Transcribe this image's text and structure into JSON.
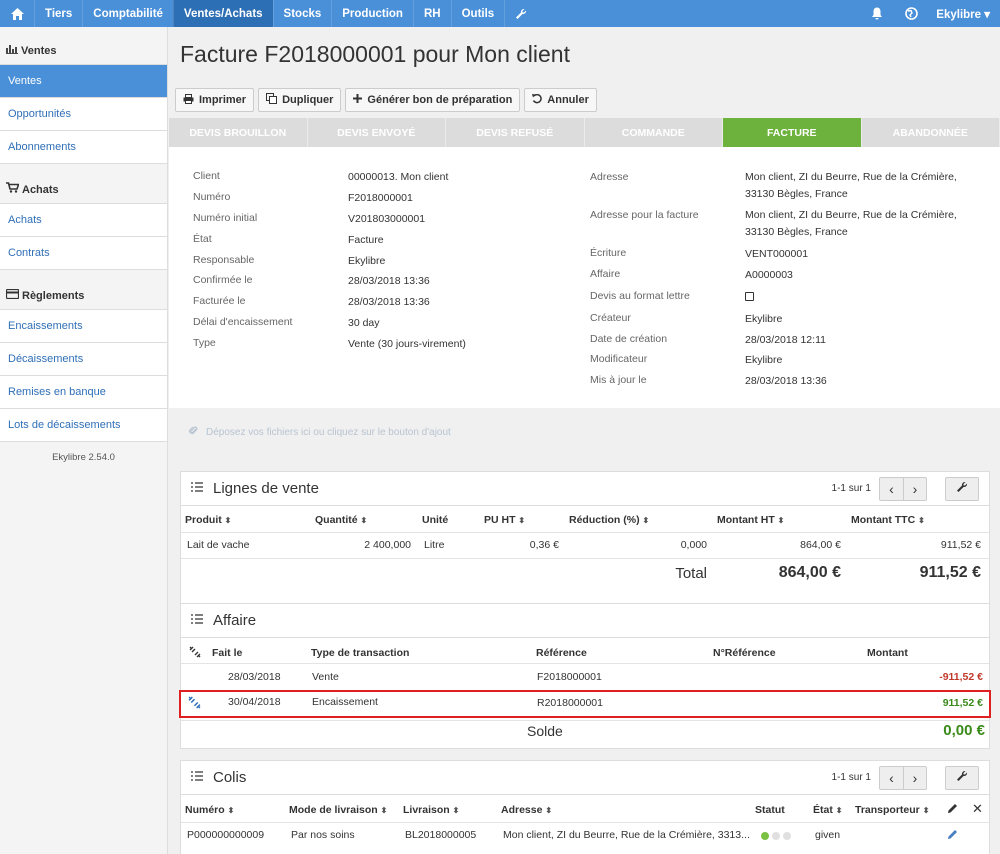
{
  "nav": {
    "menu": [
      "Tiers",
      "Comptabilité",
      "Ventes/Achats",
      "Stocks",
      "Production",
      "RH",
      "Outils"
    ],
    "user": "Ekylibre"
  },
  "sidebar": {
    "sections": [
      {
        "title": "Ventes",
        "items": [
          "Ventes",
          "Opportunités",
          "Abonnements"
        ]
      },
      {
        "title": "Achats",
        "items": [
          "Achats",
          "Contrats"
        ]
      },
      {
        "title": "Règlements",
        "items": [
          "Encaissements",
          "Décaissements",
          "Remises en banque",
          "Lots de décaissements"
        ]
      }
    ],
    "version": "Ekylibre 2.54.0"
  },
  "page": {
    "title": "Facture F2018000001 pour Mon client",
    "actions": [
      "Imprimer",
      "Dupliquer",
      "Générer bon de préparation",
      "Annuler"
    ],
    "steps": [
      "DEVIS BROUILLON",
      "DEVIS ENVOYÉ",
      "DEVIS REFUSÉ",
      "COMMANDE",
      "FACTURE",
      "ABANDONNÉE"
    ],
    "dropzone": "Déposez vos fichiers ici ou cliquez sur le bouton d'ajout"
  },
  "info_left": [
    {
      "label": "Client",
      "value": "00000013. Mon client",
      "link": true
    },
    {
      "label": "Numéro",
      "value": "F2018000001"
    },
    {
      "label": "Numéro initial",
      "value": "V201803000001"
    },
    {
      "label": "État",
      "value": "Facture"
    },
    {
      "label": "Responsable",
      "value": "Ekylibre"
    },
    {
      "label": "Confirmée le",
      "value": "28/03/2018 13:36"
    },
    {
      "label": "Facturée le",
      "value": "28/03/2018 13:36"
    },
    {
      "label": "Délai d'encaissement",
      "value": "30 day"
    },
    {
      "label": "Type",
      "value": "Vente (30 jours-virement)"
    }
  ],
  "info_right": {
    "adresse_label": "Adresse",
    "adresse_1": "Mon client, ZI du Beurre, Rue de la Crémière,",
    "adresse_2": "33130 Bègles, France",
    "adresse_fact_label": "Adresse pour la facture",
    "adresse_fact_1": "Mon client, ZI du Beurre, Rue de la Crémière,",
    "adresse_fact_2": "33130 Bègles, France",
    "ecriture_label": "Écriture",
    "ecriture": "VENT000001",
    "affaire_label": "Affaire",
    "affaire": "A0000003",
    "devis_label": "Devis au format lettre",
    "createur_label": "Créateur",
    "createur": "Ekylibre",
    "date_creation_label": "Date de création",
    "date_creation": "28/03/2018 12:11",
    "modificateur_label": "Modificateur",
    "modificateur": "Ekylibre",
    "maj_label": "Mis à jour le",
    "maj": "28/03/2018 13:36"
  },
  "lignes": {
    "title": "Lignes de vente",
    "pager": "1-1 sur 1",
    "headers": [
      "Produit",
      "Quantité",
      "Unité",
      "PU HT",
      "Réduction (%)",
      "Montant HT",
      "Montant TTC"
    ],
    "row": [
      "Lait de vache",
      "2 400,000",
      "Litre",
      "0,36 €",
      "0,000",
      "864,00 €",
      "911,52 €"
    ],
    "total_label": "Total",
    "total_ht": "864,00 €",
    "total_ttc": "911,52 €"
  },
  "affaire": {
    "title": "Affaire",
    "headers": [
      "Fait le",
      "Type de transaction",
      "Référence",
      "N°Référence",
      "Montant"
    ],
    "rows": [
      {
        "date": "28/03/2018",
        "type": "Vente",
        "ref": "F2018000001",
        "montant": "-911,52 €"
      },
      {
        "date": "30/04/2018",
        "type": "Encaissement",
        "ref": "R2018000001",
        "montant": "911,52 €"
      }
    ],
    "solde_label": "Solde",
    "solde": "0,00 €"
  },
  "colis": {
    "title": "Colis",
    "pager": "1-1 sur 1",
    "headers": [
      "Numéro",
      "Mode de livraison",
      "Livraison",
      "Adresse",
      "Statut",
      "État",
      "Transporteur"
    ],
    "row": [
      "P000000000009",
      "Par nos soins",
      "BL2018000005",
      "Mon client, ZI du Beurre, Rue de la Crémière, 3313...",
      "",
      "given",
      ""
    ]
  }
}
